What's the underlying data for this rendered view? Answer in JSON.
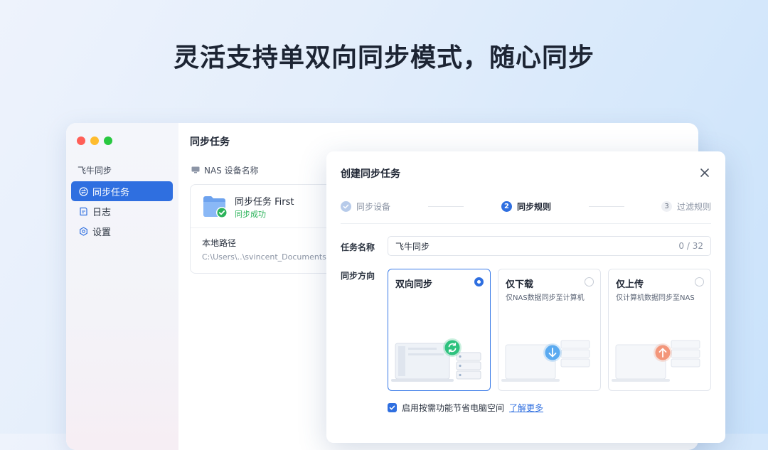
{
  "headline": "灵活支持单双向同步模式，随心同步",
  "app": {
    "name": "飞牛同步",
    "nav": [
      {
        "label": "同步任务",
        "icon": "sync-icon",
        "active": true
      },
      {
        "label": "日志",
        "icon": "log-icon",
        "active": false
      },
      {
        "label": "设置",
        "icon": "gear-icon",
        "active": false
      }
    ]
  },
  "main": {
    "title": "同步任务",
    "nas_label": "NAS 设备名称",
    "task": {
      "name": "同步任务 First",
      "status": "同步成功",
      "path_label": "本地路径",
      "path_value": "C:\\Users\\..\\svincent_Documents"
    }
  },
  "dialog": {
    "title": "创建同步任务",
    "steps": [
      {
        "number": "1",
        "label": "同步设备",
        "state": "done"
      },
      {
        "number": "2",
        "label": "同步规则",
        "state": "current"
      },
      {
        "number": "3",
        "label": "过滤规则",
        "state": "todo"
      }
    ],
    "task_name_label": "任务名称",
    "task_name_value": "飞牛同步",
    "task_name_counter": "0 / 32",
    "direction_label": "同步方向",
    "options": [
      {
        "title": "双向同步",
        "desc": "",
        "selected": true,
        "badge_color": "#2ec27e"
      },
      {
        "title": "仅下载",
        "desc": "仅NAS数据同步至计算机",
        "selected": false,
        "badge_color": "#5aaaf0"
      },
      {
        "title": "仅上传",
        "desc": "仅计算机数据同步至NAS",
        "selected": false,
        "badge_color": "#f3967a"
      }
    ],
    "checkbox_label": "启用按需功能节省电脑空间",
    "checkbox_checked": true,
    "learn_more": "了解更多"
  },
  "colors": {
    "accent": "#2f6fe0",
    "success": "#2bb35a"
  }
}
